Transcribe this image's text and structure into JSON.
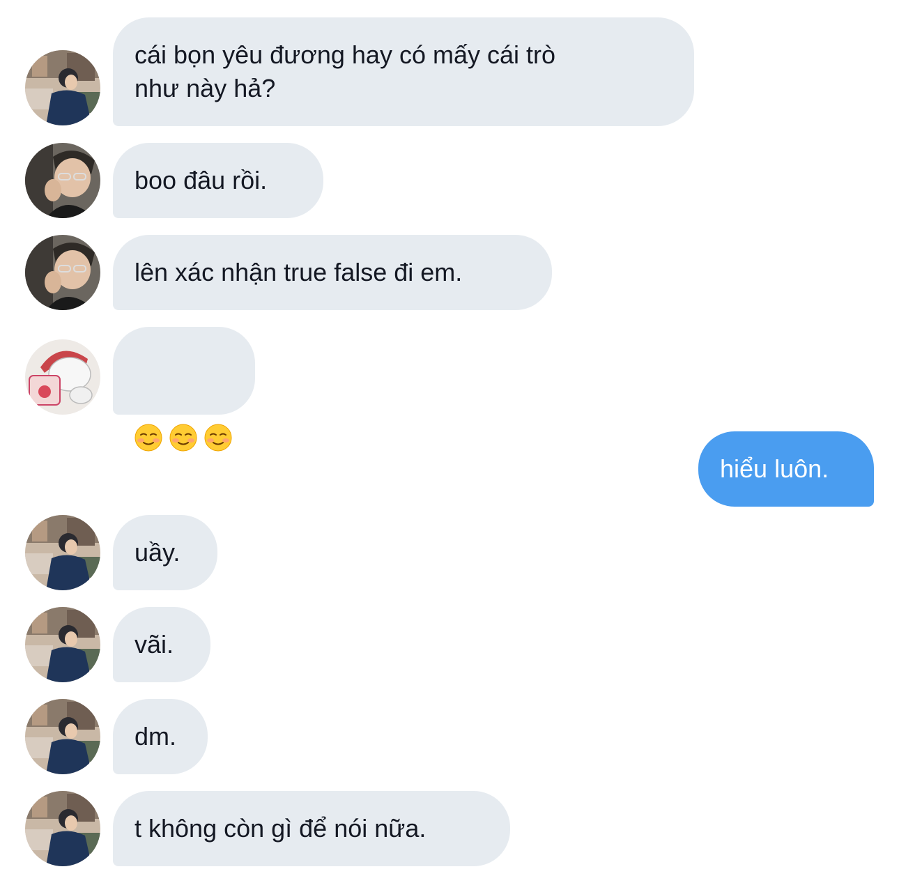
{
  "messages": [
    {
      "sender": "a",
      "text": "cái bọn yêu đương hay có mấy cái trò\nnhư này hả?"
    },
    {
      "sender": "b",
      "text": "boo đâu rồi."
    },
    {
      "sender": "b",
      "text": "lên xác nhận true false đi em."
    },
    {
      "sender": "c",
      "emoji": [
        "smiling-face",
        "smiling-face",
        "smiling-face"
      ]
    },
    {
      "sender": "me",
      "text": "hiểu luôn."
    },
    {
      "sender": "a",
      "text": "uầy."
    },
    {
      "sender": "a",
      "text": "vãi."
    },
    {
      "sender": "a",
      "text": "dm."
    },
    {
      "sender": "a",
      "text": "t không còn gì để nói nữa."
    }
  ],
  "avatars": {
    "a": {
      "kind": "photo-street-jacket",
      "icon": "avatar-a"
    },
    "b": {
      "kind": "photo-glasses",
      "icon": "avatar-b"
    },
    "c": {
      "kind": "cartoon-bear-icecream",
      "icon": "avatar-c"
    }
  },
  "colors": {
    "incoming_bubble": "#e6ebf0",
    "outgoing_bubble": "#4a9df0",
    "incoming_text": "#141823",
    "outgoing_text": "#ffffff"
  }
}
